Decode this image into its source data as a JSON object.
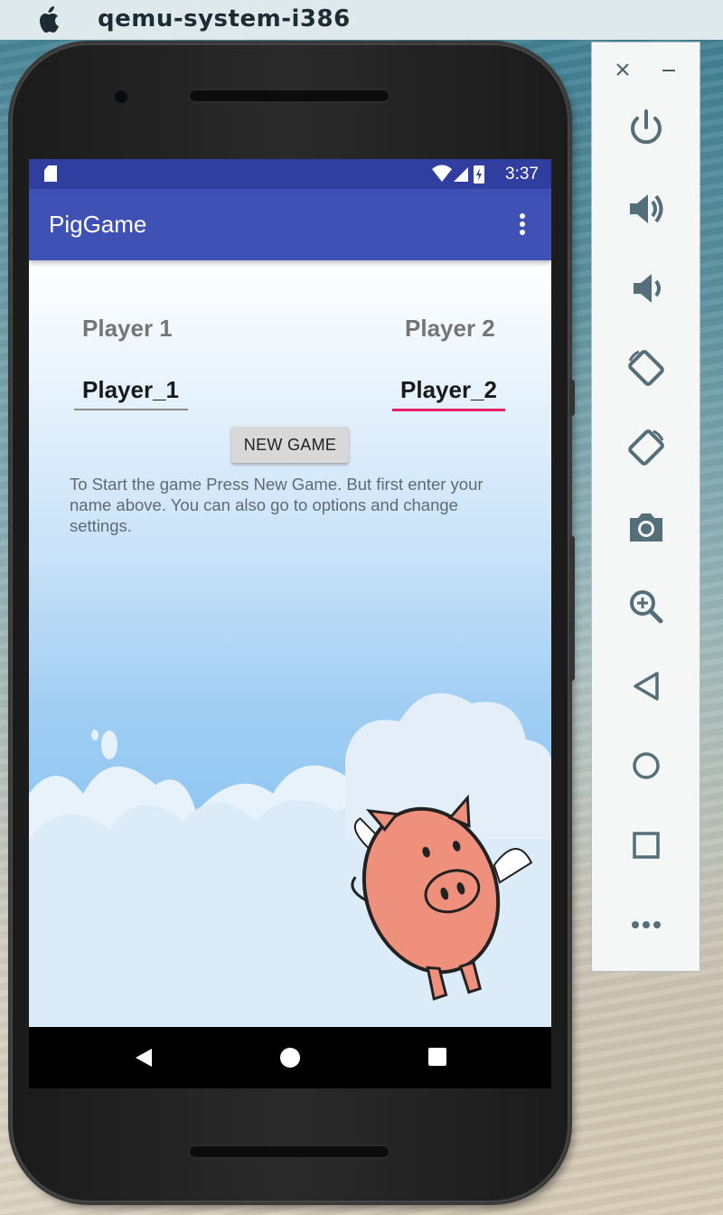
{
  "mac_window": {
    "title": "qemu-system-i386"
  },
  "status_bar": {
    "time": "3:37"
  },
  "app": {
    "title": "PigGame",
    "player1_label": "Player 1",
    "player2_label": "Player 2",
    "player1_name": "Player_1",
    "player2_name": "Player_2",
    "new_game_label": "NEW GAME",
    "instructions": "To Start the game Press New Game. But first enter your name above. You can also go to options and change settings."
  },
  "colors": {
    "status_bar": "#303f9f",
    "app_bar": "#3f51b5",
    "focus_underline": "#e91e63",
    "pig_body": "#ef907c"
  },
  "emulator_panel": {
    "controls": [
      "close-icon",
      "minimize-icon",
      "power-icon",
      "volume-up-icon",
      "volume-down-icon",
      "rotate-left-icon",
      "rotate-right-icon",
      "camera-icon",
      "zoom-icon",
      "back-icon",
      "home-icon",
      "overview-icon",
      "more-icon"
    ]
  }
}
